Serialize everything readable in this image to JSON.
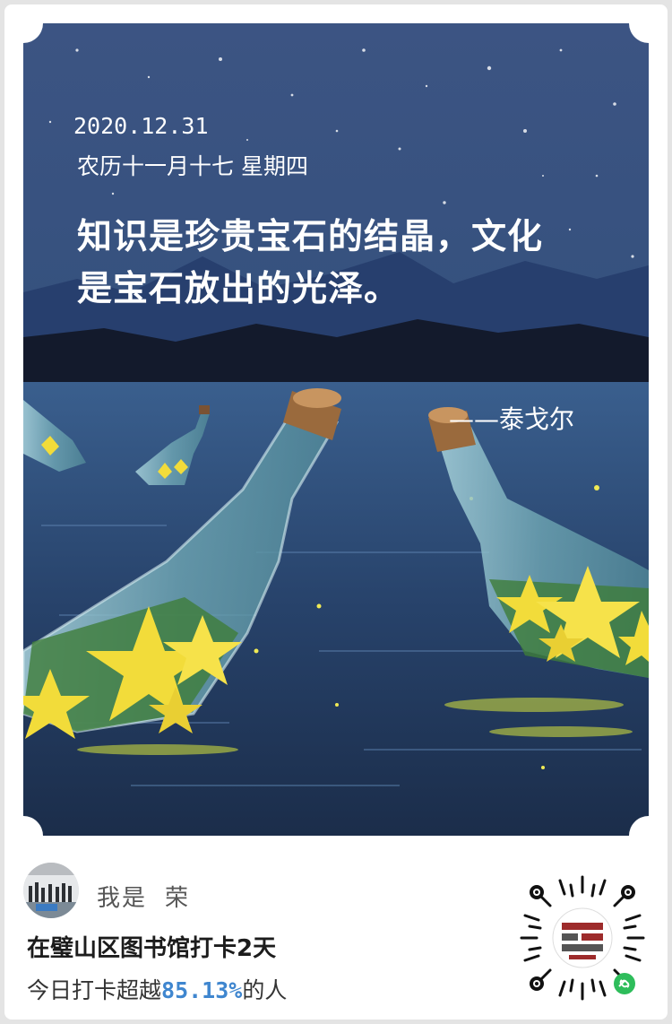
{
  "poster": {
    "date": "2020.12.31",
    "lunar_date": "农历十一月十七 星期四",
    "quote_line1": "知识是珍贵宝石的结晶，文化",
    "quote_line2": "是宝石放出的光泽。",
    "author": "——泰戈尔"
  },
  "user": {
    "name_prefix": "我是",
    "name_suffix": "荣"
  },
  "checkin": {
    "text": "在璧山区图书馆打卡2天",
    "rank_prefix": "今日打卡超越",
    "rank_percent": "85.13%",
    "rank_suffix": "的人"
  },
  "colors": {
    "sky_top": "#3c5483",
    "sky_bottom": "#2a3c63",
    "water": "#27426a",
    "star_yellow": "#f2dc3a",
    "accent_blue": "#3f86cf"
  },
  "icons": {
    "qr": "mini-program-qr-code",
    "badge": "link-icon"
  }
}
